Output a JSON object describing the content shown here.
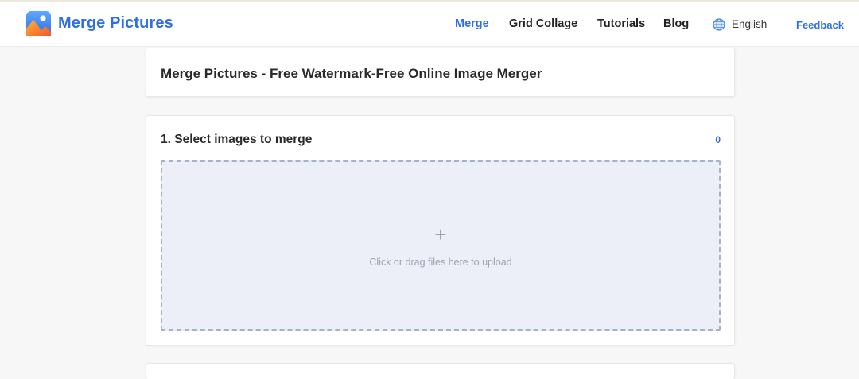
{
  "brand": {
    "name": "Merge Pictures"
  },
  "nav": {
    "items": [
      {
        "label": "Merge",
        "active": true
      },
      {
        "label": "Grid Collage",
        "active": false
      },
      {
        "label": "Tutorials",
        "active": false
      },
      {
        "label": "Blog",
        "active": false
      }
    ],
    "language": "English",
    "feedback": "Feedback"
  },
  "page": {
    "title": "Merge Pictures - Free Watermark-Free Online Image Merger"
  },
  "select_section": {
    "title": "1. Select images to merge",
    "count": "0",
    "dropzone_icon": "+",
    "dropzone_hint": "Click or drag files here to upload"
  },
  "colors": {
    "accent": "#2f6fe0",
    "dropzone_bg": "#eceff7",
    "dropzone_border": "#a5b2c8"
  },
  "icons": {
    "logo": "picture-logo-icon",
    "language": "globe-icon",
    "upload": "plus-icon"
  }
}
